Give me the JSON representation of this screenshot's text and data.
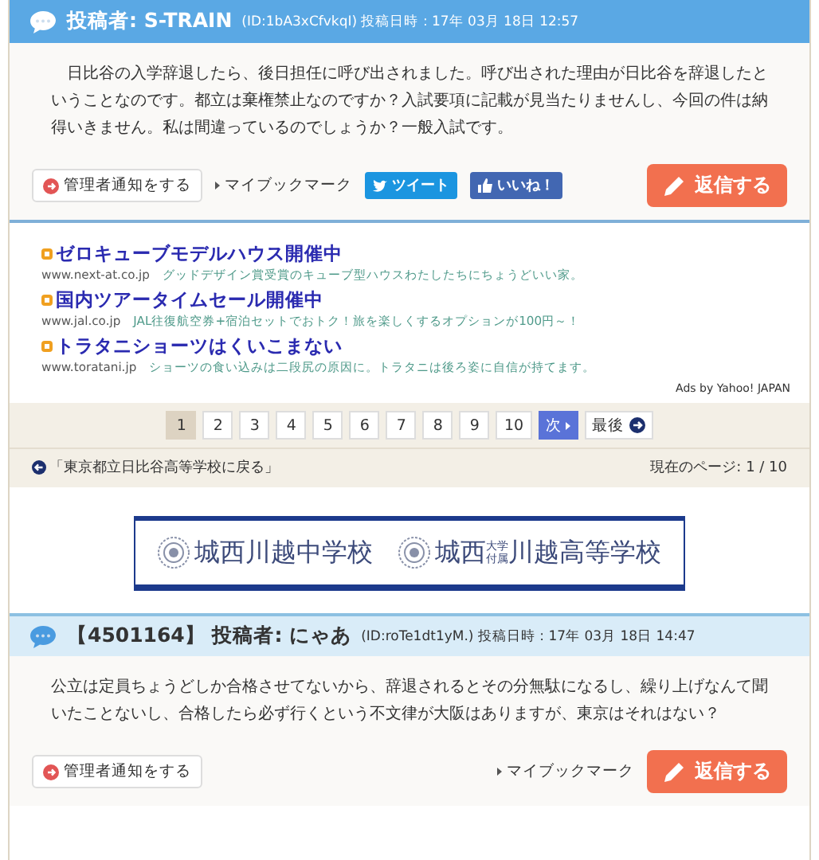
{
  "posts": [
    {
      "kind": "featured",
      "author_label": "投稿者:",
      "author": "S-TRAIN",
      "meta": "(ID:1bA3xCfvkqI) 投稿日時 : 17年 03月 18日 12:57",
      "body": "　日比谷の入学辞退したら、後日担任に呼び出されました。呼び出された理由が日比谷を辞退したということなのです。都立は棄権禁止なのですか？入試要項に記載が見当たりませんし、今回の件は納得いきません。私は間違っているのでしょうか？一般入試です。",
      "report": "管理者通知をする",
      "bookmark": "マイブックマーク",
      "share": [
        {
          "kind": "tweet",
          "label": "ツイート"
        },
        {
          "kind": "like",
          "label": "いいね！"
        }
      ],
      "reply": "返信する"
    },
    {
      "kind": "regular",
      "number": "【4501164】",
      "author_label": "投稿者:",
      "author": "にゃあ",
      "meta": "(ID:roTe1dt1yM.) 投稿日時 : 17年 03月 18日 14:47",
      "body": "公立は定員ちょうどしか合格させてないから、辞退されるとその分無駄になるし、繰り上げなんて聞いたことないし、合格したら必ず行くという不文律が大阪はありますが、東京はそれはない？",
      "report": "管理者通知をする",
      "bookmark": "マイブックマーク",
      "reply": "返信する"
    }
  ],
  "ads": {
    "items": [
      {
        "title": "ゼロキューブモデルハウス開催中",
        "url": "www.next-at.co.jp",
        "text": "グッドデザイン賞受賞のキューブ型ハウスわたしたちにちょうどいい家。"
      },
      {
        "title": "国内ツアータイムセール開催中",
        "url": "www.jal.co.jp",
        "text": "JAL往復航空券+宿泊セットでおトク！旅を楽しくするオプションが100円～！"
      },
      {
        "title": "トラタニショーツはくいこまない",
        "url": "www.toratani.jp",
        "text": "ショーツの食い込みは二段尻の原因に。トラタニは後ろ姿に自信が持てます。"
      }
    ],
    "credit": "Ads by Yahoo! JAPAN"
  },
  "pagination": {
    "pages": [
      {
        "label": "1",
        "selected": true
      },
      {
        "label": "2",
        "selected": false
      },
      {
        "label": "3",
        "selected": false
      },
      {
        "label": "4",
        "selected": false
      },
      {
        "label": "5",
        "selected": false
      },
      {
        "label": "6",
        "selected": false
      },
      {
        "label": "7",
        "selected": false
      },
      {
        "label": "8",
        "selected": false
      },
      {
        "label": "9",
        "selected": false
      },
      {
        "label": "10",
        "selected": false
      }
    ],
    "next": "次",
    "last": "最後"
  },
  "back_link": "「東京都立日比谷高等学校に戻る」",
  "current_page": "現在のページ: 1 / 10",
  "banner": {
    "schools": [
      {
        "prefix": "城西",
        "suffix": "川越中学校"
      },
      {
        "prefix": "城西",
        "small": [
          "大学",
          "付属"
        ],
        "suffix": "川越高等学校"
      }
    ]
  }
}
